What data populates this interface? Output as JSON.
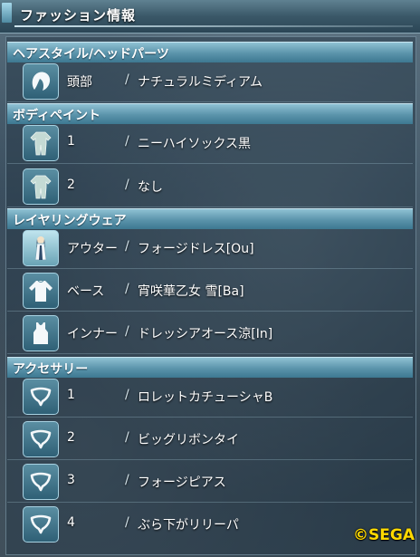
{
  "window": {
    "title": "ファッション情報"
  },
  "sections": {
    "hair": {
      "header": "ヘアスタイル/ヘッドパーツ",
      "rows": [
        {
          "label": "頭部",
          "slash": "/",
          "value": "ナチュラルミディアム",
          "icon": "hair-icon"
        }
      ]
    },
    "bodypaint": {
      "header": "ボディペイント",
      "rows": [
        {
          "label": "1",
          "slash": "/",
          "value": "ニーハイソックス黒",
          "icon": "bodysuit-icon"
        },
        {
          "label": "2",
          "slash": "/",
          "value": "なし",
          "icon": "bodysuit-icon"
        }
      ]
    },
    "layering": {
      "header": "レイヤリングウェア",
      "rows": [
        {
          "label": "アウター",
          "slash": "/",
          "value": "フォージドレス[Ou]",
          "icon": "outfit-preview-icon"
        },
        {
          "label": "ベース",
          "slash": "/",
          "value": "宵咲華乙女 雪[Ba]",
          "icon": "longsleeve-shirt-icon"
        },
        {
          "label": "インナー",
          "slash": "/",
          "value": "ドレッシアオース涼[In]",
          "icon": "tank-top-icon"
        }
      ]
    },
    "accessory": {
      "header": "アクセサリー",
      "rows": [
        {
          "label": "1",
          "slash": "/",
          "value": "ロレットカチューシャB",
          "icon": "necklace-icon"
        },
        {
          "label": "2",
          "slash": "/",
          "value": "ビッグリボンタイ",
          "icon": "necklace-icon"
        },
        {
          "label": "3",
          "slash": "/",
          "value": "フォージピアス",
          "icon": "necklace-icon"
        },
        {
          "label": "4",
          "slash": "/",
          "value": "ぶら下がリリーパ",
          "icon": "necklace-icon"
        }
      ]
    }
  },
  "footer": {
    "copyright": "©SEGA"
  },
  "colors": {
    "header": "#5a93aa",
    "copyright": "#ffd900"
  }
}
